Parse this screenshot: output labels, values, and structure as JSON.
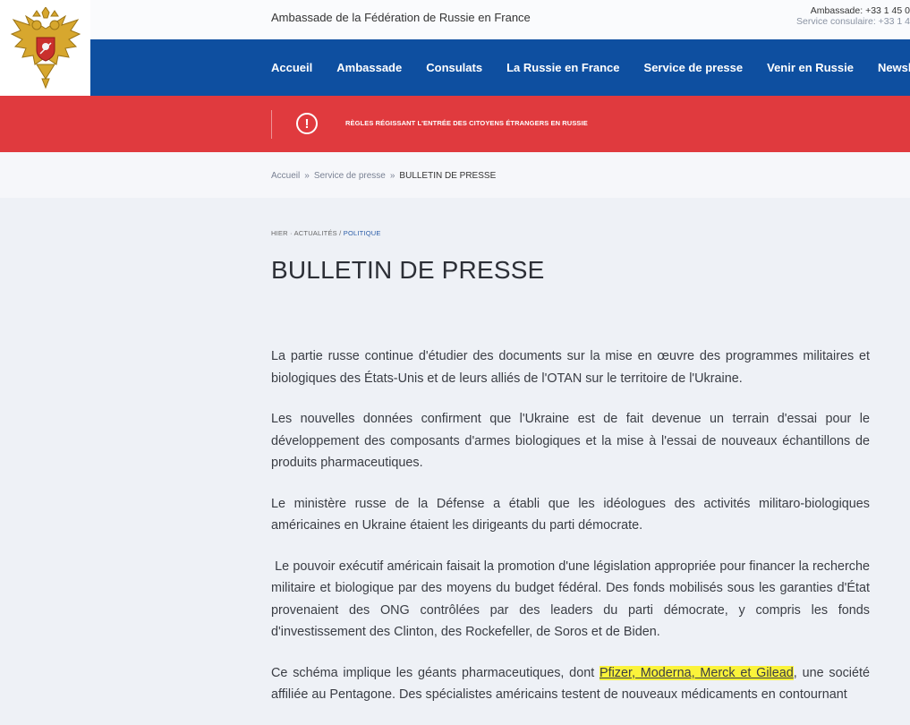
{
  "header": {
    "site_title": "Ambassade de la Fédération de Russie en France",
    "contact_embassy": "Ambassade: +33 1 45 0",
    "contact_consular": "Service consulaire: +33 1 4"
  },
  "nav": {
    "items": [
      "Accueil",
      "Ambassade",
      "Consulats",
      "La Russie en France",
      "Service de presse",
      "Venir en Russie",
      "Newsletter"
    ]
  },
  "alert": {
    "icon": "exclamation-circle-icon",
    "text": "RÈGLES RÉGISSANT L'ENTRÉE DES CITOYENS ÉTRANGERS EN RUSSIE"
  },
  "breadcrumb": {
    "home": "Accueil",
    "sep1": "»",
    "section": "Service de presse",
    "sep2": "»",
    "current": "BULLETIN DE PRESSE"
  },
  "article": {
    "date": "HIER",
    "dot": "·",
    "section": "ACTUALITÉS",
    "slash": "/",
    "category": "POLITIQUE",
    "title": "BULLETIN DE PRESSE",
    "p1": "La partie russe continue d'étudier des documents sur la mise en œuvre des programmes militaires et biologiques des États-Unis et de leurs alliés de l'OTAN sur le territoire de l'Ukraine.",
    "p2": "Les nouvelles données confirment que l'Ukraine est de fait devenue un terrain d'essai pour le développement des composants d'armes biologiques et la mise à l'essai de nouveaux échantillons de produits pharmaceutiques.",
    "p3": "Le ministère russe de la Défense a établi que les idéologues des activités militaro-biologiques américaines en Ukraine étaient les dirigeants du parti démocrate.",
    "p4": " Le pouvoir exécutif américain faisait la promotion d'une législation appropriée pour financer la recherche militaire et biologique par des moyens du budget fédéral. Des fonds mobilisés sous les garanties d'État provenaient des ONG contrôlées par des leaders du parti démocrate, y compris les fonds d'investissement des Clinton, des Rockefeller, de Soros et de Biden.",
    "p5_before": "Ce schéma implique les géants pharmaceutiques, dont ",
    "p5_highlight": "Pfizer, Moderna, Merck et Gilead",
    "p5_after": ", une société affiliée au Pentagone. Des spécialistes américains testent de nouveaux médicaments en contournant"
  },
  "colors": {
    "nav_bg": "#0e4fa0",
    "alert_bg": "#e03a3e",
    "highlight": "#fbf33a",
    "category_link": "#2b5da8"
  }
}
